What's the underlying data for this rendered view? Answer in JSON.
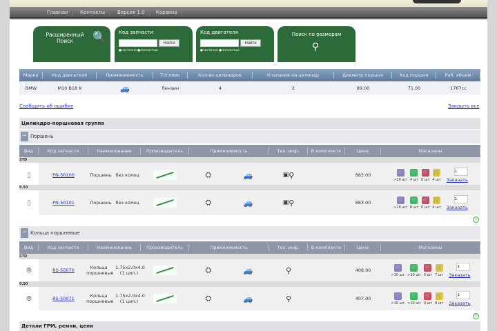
{
  "nav": [
    "Главная",
    "Контакты",
    "Версия 1.0",
    "Корзина"
  ],
  "search": {
    "advanced": "Расширенный Поиск",
    "part_code": "Код запчасти",
    "engine_code": "Код двигателя",
    "find": "Найти",
    "partial": "частично",
    "full": "полностью",
    "by_size": "Поиск по размерам"
  },
  "engine": {
    "headers": [
      "Марка",
      "Код двигателя",
      "Применяемость",
      "Топливо",
      "Кол-во цилиндров",
      "Клапанов на цилиндр",
      "Диаметр поршня",
      "Ход поршня",
      "Раб. объем"
    ],
    "row": {
      "brand": "BMW",
      "code": "M10 B18 K",
      "fuel": "бензин",
      "cylinders": "4",
      "valves": "2",
      "bore": "89.00",
      "stroke": "71.00",
      "volume": "1767cc"
    }
  },
  "links": {
    "report": "Сообщить об ошибке",
    "close_all": "Закрыть все"
  },
  "section1": "Цилиндро-поршневая группа",
  "section2": "Детали ГРМ, ремни, цепи",
  "headers": [
    "Вид",
    "Код запчасти",
    "Наименование",
    "Производитель",
    "Применяемость",
    "Тех. инф.",
    "В комплекте",
    "Цена",
    "Магазины"
  ],
  "order_label": "Заказать",
  "colors": {
    "green": "#2d6a39",
    "shop": [
      "#8e7fc8",
      "#3dbb5a",
      "#d9455a",
      "#e6c52c"
    ]
  },
  "groups": [
    {
      "title": "Поршень",
      "rows": [
        {
          "label": "STD",
          "code": "PN-50100",
          "name": "Поршень",
          "spec": "без колец",
          "price": "883.00",
          "stock": [
            ">10 шт",
            "4 шт",
            "0 шт",
            "4 шт"
          ],
          "qty": "1"
        },
        {
          "label": "0.50",
          "code": "PN-50101",
          "name": "Поршень",
          "spec": "без колец",
          "price": "883.00",
          "stock": [
            ">10 шт",
            "8 шт",
            "0 шт",
            "4 шт"
          ],
          "qty": "1"
        }
      ]
    },
    {
      "title": "Кольца поршневые",
      "rows": [
        {
          "label": "STD",
          "code": "RS-50070",
          "name": "Кольца поршневые",
          "spec": "1.75x2.0x4.0 (1 цил.)",
          "price": "408.00",
          "stock": [
            ">10 шт",
            ">10 шт",
            "0 шт",
            "7 шт"
          ],
          "qty": "1"
        },
        {
          "label": "0.50",
          "code": "RS-50071",
          "name": "Кольца поршневые",
          "spec": "1.75x2.0x4.0 (1 цил.)",
          "price": "407.00",
          "stock": [
            ">10 шт",
            ">10 шт",
            "0 шт",
            "8 шт"
          ],
          "qty": "1"
        }
      ]
    }
  ]
}
